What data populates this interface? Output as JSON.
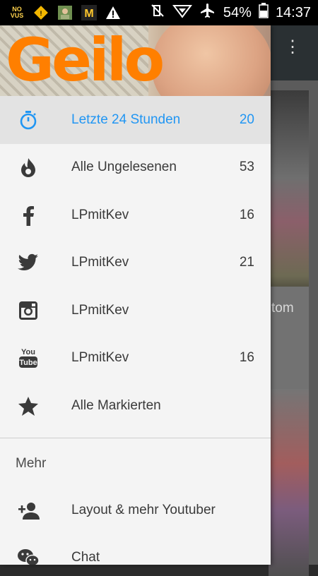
{
  "status_bar": {
    "battery": "54%",
    "time": "14:37",
    "notif_icons": [
      "novus-icon",
      "warning-diamond-icon",
      "photo-icon",
      "mcdonalds-icon",
      "alert-triangle-icon"
    ]
  },
  "drawer": {
    "header_title": "Geilo",
    "items": [
      {
        "label": "Letzte 24 Stunden",
        "count": "20",
        "icon": "timer-icon",
        "active": true
      },
      {
        "label": "Alle Ungelesenen",
        "count": "53",
        "icon": "flame-icon"
      },
      {
        "label": "LPmitKev",
        "count": "16",
        "icon": "facebook-icon"
      },
      {
        "label": "LPmitKev",
        "count": "21",
        "icon": "twitter-icon"
      },
      {
        "label": "LPmitKev",
        "count": "",
        "icon": "instagram-icon"
      },
      {
        "label": "LPmitKev",
        "count": "16",
        "icon": "youtube-icon"
      },
      {
        "label": "Alle Markierten",
        "count": "",
        "icon": "star-icon"
      }
    ],
    "section_title": "Mehr",
    "more_items": [
      {
        "label": "Layout & mehr Youtuber",
        "icon": "add-person-icon"
      },
      {
        "label": "Chat",
        "icon": "chat-icon"
      }
    ]
  },
  "background": {
    "visible_text": "tom"
  },
  "colors": {
    "accent": "#2196f3",
    "header_title": "#ff7f00"
  }
}
